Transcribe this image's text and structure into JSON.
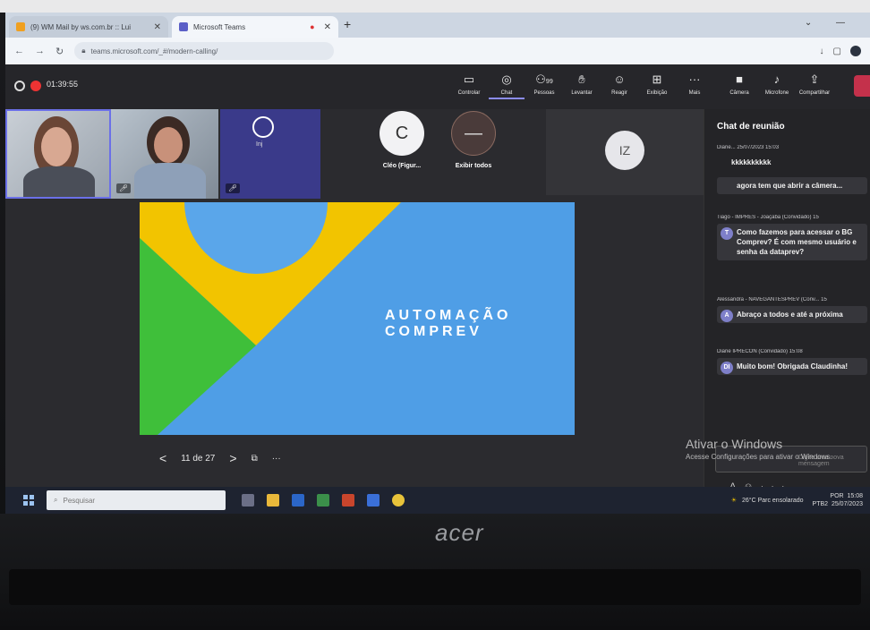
{
  "browser": {
    "tabs": [
      {
        "title": "(9) WM Mail by ws.com.br :: Lui",
        "active": false
      },
      {
        "title": "Microsoft Teams",
        "active": true
      }
    ],
    "new_tab": "+",
    "url": "teams.microsoft.com/_#/modern-calling/"
  },
  "teams": {
    "timer": "01:39:55",
    "toolbar": [
      {
        "label": "Controlar",
        "icon": "share-control-icon"
      },
      {
        "label": "Chat",
        "icon": "chat-icon",
        "active": true
      },
      {
        "label": "Pessoas",
        "icon": "people-icon",
        "badge": "99"
      },
      {
        "label": "Levantar",
        "icon": "raise-hand-icon"
      },
      {
        "label": "Reagir",
        "icon": "react-icon"
      },
      {
        "label": "Exibição",
        "icon": "view-icon"
      },
      {
        "label": "Mais",
        "icon": "more-icon"
      },
      {
        "label": "Câmera",
        "icon": "camera-off-icon"
      },
      {
        "label": "Microfone",
        "icon": "mic-off-icon"
      },
      {
        "label": "Compartilhar",
        "icon": "share-icon"
      }
    ],
    "participants": {
      "thumb3_name": "Inj",
      "tile_c": {
        "initial": "C",
        "name": "Cléo (Figur..."
      },
      "tile_all": {
        "initial": "—",
        "name": "Exibir todos"
      },
      "tile_iz": {
        "initial": "IZ"
      }
    },
    "slide": {
      "title_line1": "AUTOMAÇÃO",
      "title_line2": "COMPREV",
      "colors": {
        "blue": "#4f9ee6",
        "yellow": "#f2c400",
        "green": "#3fbf3a"
      }
    },
    "slide_nav": {
      "prev": "<",
      "counter": "11 de 27",
      "next": ">",
      "more": "···"
    },
    "chat": {
      "title": "Chat de reunião",
      "messages": [
        {
          "header": "Diane... 25/07/2023 15:03",
          "body": "kkkkkkkkkk",
          "avatar": ""
        },
        {
          "header": "",
          "body": "agora tem que abrir a câmera...",
          "avatar": ""
        },
        {
          "header": "Tiago - IMPRES - Joaçaba (Convidado) 15",
          "body": "Como fazemos para acessar o BG Comprev? É com mesmo usuário e senha da dataprev?",
          "avatar": "T"
        },
        {
          "header": "Alessandra - NAVEGANTESPREV (Conv... 15",
          "body": "Abraço a todos e até a próxima",
          "avatar": "A"
        },
        {
          "header": "Diane IPRECON (Convidado) 15:08",
          "body": "Muito bom! Obrigada Claudinha!",
          "avatar": "DI"
        }
      ],
      "compose_placeholder": "Digite uma nova mensagem"
    },
    "activation": {
      "line1": "Ativar o Windows",
      "line2": "Acesse Configurações para ativar o Windows."
    }
  },
  "taskbar": {
    "search_placeholder": "Pesquisar",
    "weather": "26°C  Parc ensolarado",
    "lang": "POR",
    "lang2": "PTB2",
    "time": "15:08",
    "date": "25/07/2023"
  },
  "laptop": {
    "brand": "acer"
  }
}
